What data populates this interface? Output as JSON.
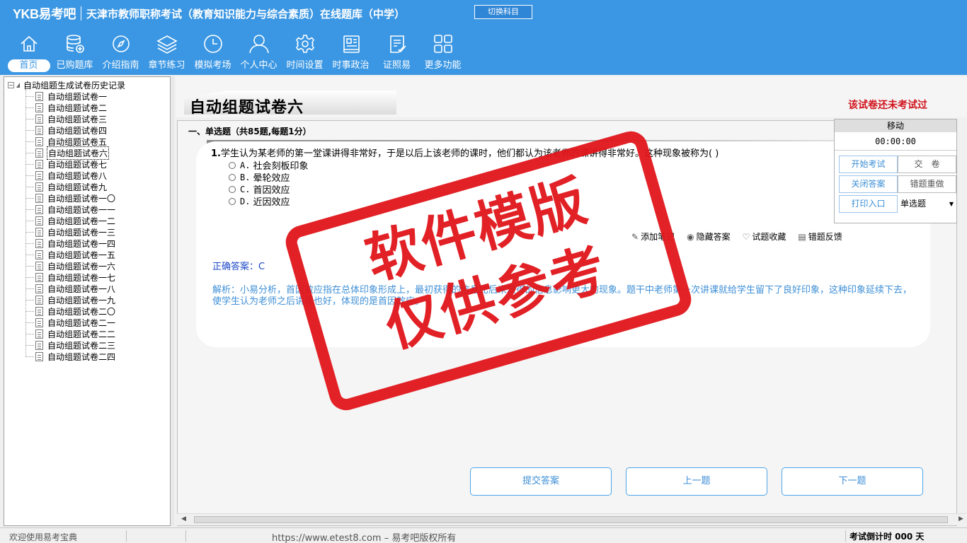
{
  "header": {
    "logo": "YKB易考吧",
    "title": "天津市教师职称考试（教育知识能力与综合素质）在线题库（中学）",
    "switch_label": "切换科目"
  },
  "nav": [
    {
      "label": "首页",
      "icon": "home-icon"
    },
    {
      "label": "已购题库",
      "icon": "database-icon"
    },
    {
      "label": "介绍指南",
      "icon": "compass-icon"
    },
    {
      "label": "章节练习",
      "icon": "layers-icon"
    },
    {
      "label": "模拟考场",
      "icon": "clock-icon"
    },
    {
      "label": "个人中心",
      "icon": "user-icon"
    },
    {
      "label": "时间设置",
      "icon": "gear-icon"
    },
    {
      "label": "时事政治",
      "icon": "news-icon"
    },
    {
      "label": "证照易",
      "icon": "checklist-icon"
    },
    {
      "label": "更多功能",
      "icon": "grid-icon"
    }
  ],
  "tree": {
    "root": "自动组题生成试卷历史记录",
    "items": [
      "自动组题试卷一",
      "自动组题试卷二",
      "自动组题试卷三",
      "自动组题试卷四",
      "自动组题试卷五",
      "自动组题试卷六",
      "自动组题试卷七",
      "自动组题试卷八",
      "自动组题试卷九",
      "自动组题试卷一〇",
      "自动组题试卷一一",
      "自动组题试卷一二",
      "自动组题试卷一三",
      "自动组题试卷一四",
      "自动组题试卷一五",
      "自动组题试卷一六",
      "自动组题试卷一七",
      "自动组题试卷一八",
      "自动组题试卷一九",
      "自动组题试卷二〇",
      "自动组题试卷二一",
      "自动组题试卷二二",
      "自动组题试卷二三",
      "自动组题试卷二四"
    ]
  },
  "paper": {
    "title": "自动组题试卷六",
    "status": "该试卷还未考试过",
    "section": "一、单选题（共85题,每题1分）"
  },
  "question": {
    "number": "1.",
    "text": "学生认为某老师的第一堂课讲得非常好，于是以后上该老师的课时，他们都认为该老师的课讲得非常好。这种现象被称为( )",
    "options": [
      {
        "letter": "A.",
        "text": "社会刻板印象"
      },
      {
        "letter": "B.",
        "text": "晕轮效应"
      },
      {
        "letter": "C.",
        "text": "首因效应"
      },
      {
        "letter": "D.",
        "text": "近因效应"
      }
    ],
    "answer": "正确答案：C",
    "analysis": "解析：小易分析，首因效应指在总体印象形成上，最初获得的信息比后来获得的信息影响更大的现象。题干中老师第一次讲课就给学生留下了良好印象，这种印象延续下去，使学生认为老师之后讲课也好，体现的是首因效应。"
  },
  "actions": [
    {
      "label": "添加笔记",
      "icon": "pencil-icon"
    },
    {
      "label": "隐藏答案",
      "icon": "eye-icon"
    },
    {
      "label": "试题收藏",
      "icon": "heart-icon"
    },
    {
      "label": "错题反馈",
      "icon": "report-icon"
    }
  ],
  "buttons": {
    "submit": "提交答案",
    "prev": "上一题",
    "next": "下一题"
  },
  "panel": {
    "move": "移动",
    "timer": "00:00:00",
    "start": "开始考试",
    "hand_in": "交　卷",
    "close_answer": "关闭答案",
    "redo_wrong": "错题重做",
    "print": "打印入口",
    "type_select": "单选题"
  },
  "stamp": {
    "line1": "软件模版",
    "line2": "仅供参考"
  },
  "status": {
    "welcome": "欢迎使用易考宝典",
    "copyright": "https://www.etest8.com – 易考吧版权所有",
    "countdown": "考试倒计时 000 天"
  }
}
